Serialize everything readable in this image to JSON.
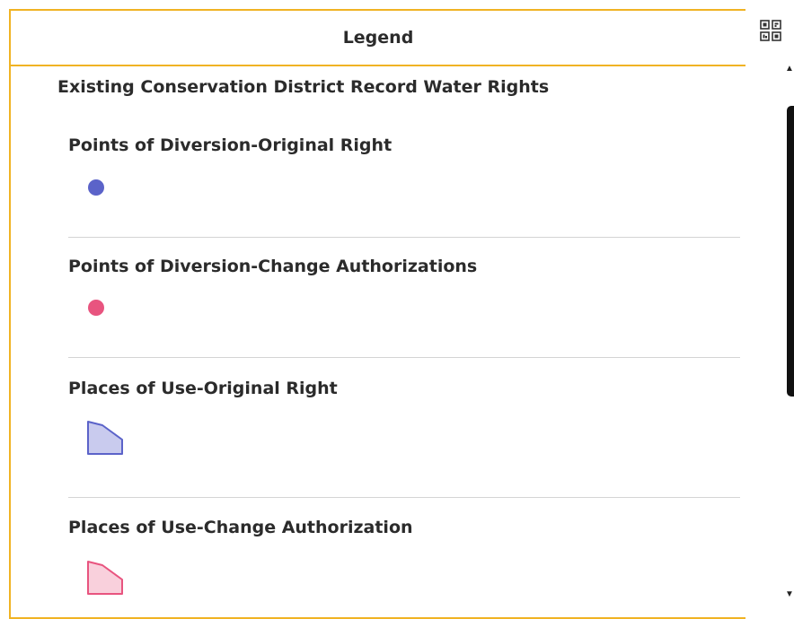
{
  "panel": {
    "title": "Legend",
    "accent_color": "#f0b323"
  },
  "toolbar": {
    "corner_button_icon": "qr-grid-icon"
  },
  "layer": {
    "title": "Existing Conservation District Record Water Rights",
    "items": [
      {
        "label": "Points of Diversion-Original Right",
        "symbol": "point",
        "color": "#5b63c9"
      },
      {
        "label": "Points of Diversion-Change Authorizations",
        "symbol": "point",
        "color": "#e8547f"
      },
      {
        "label": "Places of Use-Original Right",
        "symbol": "polygon",
        "fill": "#c9cbee",
        "stroke": "#5b63c9"
      },
      {
        "label": "Places of Use-Change Authorization",
        "symbol": "polygon",
        "fill": "#f9d0dc",
        "stroke": "#e8547f"
      }
    ]
  }
}
